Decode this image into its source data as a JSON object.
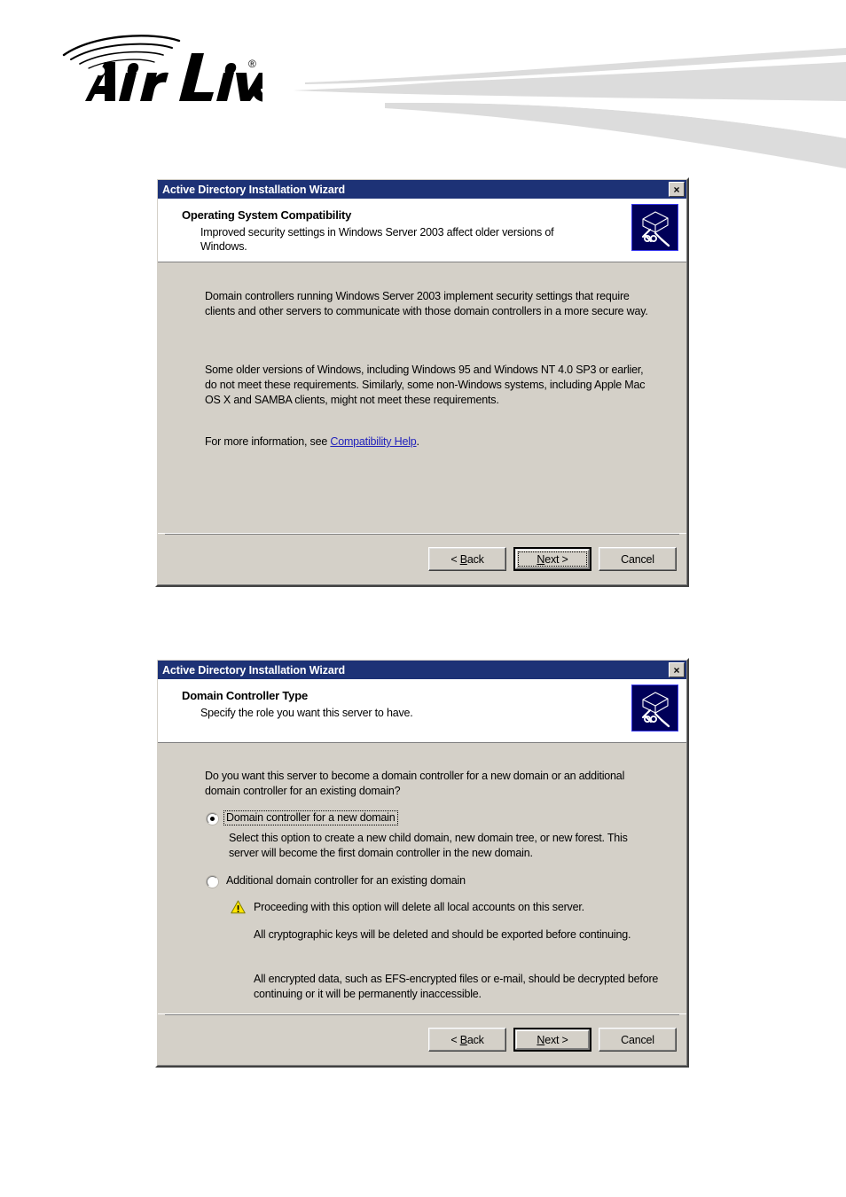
{
  "brand": {
    "logo_text": "Air Live",
    "logo_registered": "®",
    "logo_name": "airlive-logo",
    "swoosh_color": "#dcdcdc"
  },
  "theme": {
    "titlebar_bg": "#1d3276",
    "dialog_bg": "#d4d0c8",
    "header_bg": "#ffffff",
    "link_color": "#2222bb",
    "warning_color": "#ffe400",
    "icon_bg": "#000058"
  },
  "dialogs": [
    {
      "titlebar": {
        "title": "Active Directory Installation Wizard",
        "close_label": "×"
      },
      "header": {
        "title": "Operating System Compatibility",
        "subtitle": "Improved security settings in Windows Server 2003 affect older versions of Windows.",
        "icon_name": "directory-book-icon"
      },
      "body": {
        "paragraph1": "Domain controllers running Windows Server 2003 implement security settings that require clients and other servers to communicate with those domain controllers in a more secure way.",
        "paragraph2": "Some older versions of Windows, including Windows 95 and Windows NT 4.0 SP3 or earlier, do not meet these requirements. Similarly, some non-Windows systems, including Apple Mac OS X and SAMBA clients, might not meet these requirements.",
        "info_prefix": "For more information, see ",
        "info_link": "Compatibility Help",
        "info_suffix": "."
      },
      "buttons": {
        "back": "< Back",
        "next": "Next >",
        "cancel": "Cancel",
        "next_is_default": true,
        "next_is_focused": true
      }
    },
    {
      "titlebar": {
        "title": "Active Directory Installation Wizard",
        "close_label": "×"
      },
      "header": {
        "title": "Domain Controller Type",
        "subtitle": "Specify the role you want this server to have.",
        "icon_name": "directory-book-icon"
      },
      "body": {
        "question": "Do you want this server to become a domain controller for a new domain or an additional domain controller for an existing domain?",
        "option1": {
          "label": "Domain controller for a new domain",
          "selected": true,
          "focused": true,
          "description": "Select this option to create a new child domain, new domain tree, or new forest. This server will become the first domain controller in the new domain."
        },
        "option2": {
          "label": "Additional domain controller for an existing domain",
          "selected": false,
          "focused": false,
          "warning": "Proceeding with this option will delete all local accounts on this server.",
          "note1": "All cryptographic keys will be deleted and should be exported before continuing.",
          "note2": "All encrypted data, such as EFS-encrypted files or e-mail, should be decrypted before continuing or it will be permanently inaccessible."
        }
      },
      "buttons": {
        "back": "< Back",
        "next": "Next >",
        "cancel": "Cancel",
        "next_is_default": true,
        "next_is_focused": false
      }
    }
  ]
}
